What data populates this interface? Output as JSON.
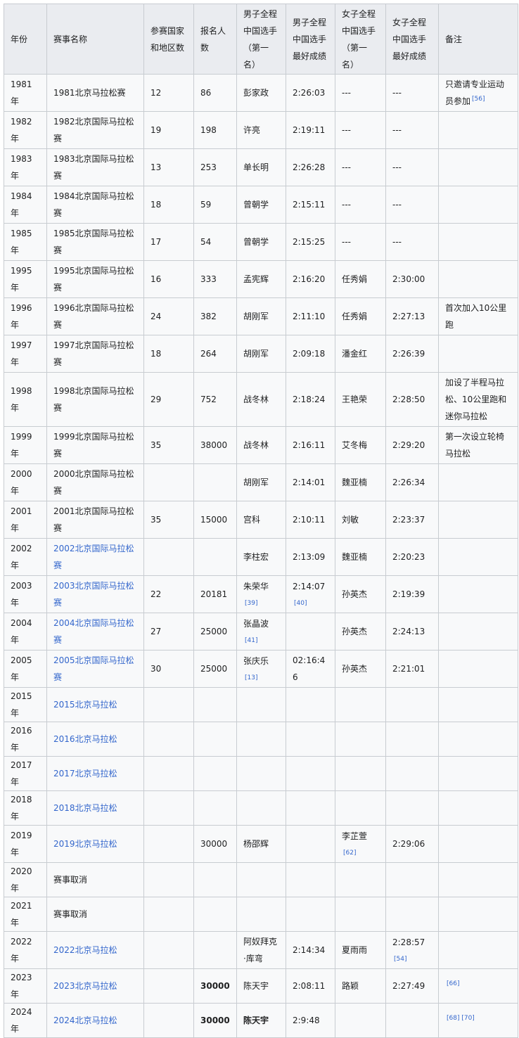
{
  "headers": {
    "year": "年份",
    "name": "赛事名称",
    "countries": "参赛国家和地区数",
    "entrants": "报名人数",
    "men_first": "男子全程中国选手（第一名）",
    "men_best": "男子全程中国选手最好成绩",
    "women_first": "女子全程中国选手（第一名）",
    "women_best": "女子全程中国选手最好成绩",
    "notes": "备注"
  },
  "rows": [
    {
      "year": "1981年",
      "name": "1981北京马拉松赛",
      "countries": "12",
      "entrants": "86",
      "men_first": "彭家政",
      "men_best": "2:26:03",
      "women_first": "---",
      "women_best": "---",
      "notes": "只邀请专业运动员参加",
      "notes_ref": "[56]"
    },
    {
      "year": "1982年",
      "name": "1982北京国际马拉松赛",
      "countries": "19",
      "entrants": "198",
      "men_first": "许亮",
      "men_best": "2:19:11",
      "women_first": "---",
      "women_best": "---",
      "notes": ""
    },
    {
      "year": "1983年",
      "name": "1983北京国际马拉松赛",
      "countries": "13",
      "entrants": "253",
      "men_first": "单长明",
      "men_best": "2:26:28",
      "women_first": "---",
      "women_best": "---",
      "notes": ""
    },
    {
      "year": "1984年",
      "name": "1984北京国际马拉松赛",
      "countries": "18",
      "entrants": "59",
      "men_first": "曾朝学",
      "men_best": "2:15:11",
      "women_first": "---",
      "women_best": "---",
      "notes": ""
    },
    {
      "year": "1985年",
      "name": "1985北京国际马拉松赛",
      "countries": "17",
      "entrants": "54",
      "men_first": "曾朝学",
      "men_best": "2:15:25",
      "women_first": "---",
      "women_best": "---",
      "notes": ""
    },
    {
      "year": "1995年",
      "name": "1995北京国际马拉松赛",
      "countries": "16",
      "entrants": "333",
      "men_first": "孟宪辉",
      "men_best": "2:16:20",
      "women_first": "任秀娟",
      "women_best": "2:30:00",
      "notes": ""
    },
    {
      "year": "1996年",
      "name": "1996北京国际马拉松赛",
      "countries": "24",
      "entrants": "382",
      "men_first": "胡刚军",
      "men_best": "2:11:10",
      "women_first": "任秀娟",
      "women_best": "2:27:13",
      "notes": "首次加入10公里跑"
    },
    {
      "year": "1997年",
      "name": "1997北京国际马拉松赛",
      "countries": "18",
      "entrants": "264",
      "men_first": "胡刚军",
      "men_best": "2:09:18",
      "women_first": "潘金红",
      "women_best": "2:26:39",
      "notes": ""
    },
    {
      "year": "1998年",
      "name": "1998北京国际马拉松赛",
      "countries": "29",
      "entrants": "752",
      "men_first": "战冬林",
      "men_best": "2:18:24",
      "women_first": "王艳荣",
      "women_best": "2:28:50",
      "notes": "加设了半程马拉松、10公里跑和迷你马拉松"
    },
    {
      "year": "1999年",
      "name": "1999北京国际马拉松赛",
      "countries": "35",
      "entrants": "38000",
      "men_first": "战冬林",
      "men_best": "2:16:11",
      "women_first": "艾冬梅",
      "women_best": "2:29:20",
      "notes": "第一次设立轮椅马拉松"
    },
    {
      "year": "2000年",
      "name": "2000北京国际马拉松赛",
      "countries": "",
      "entrants": "",
      "men_first": "胡刚军",
      "men_best": "2:14:01",
      "women_first": "魏亚楠",
      "women_best": "2:26:34",
      "notes": ""
    },
    {
      "year": "2001年",
      "name": "2001北京国际马拉松赛",
      "countries": "35",
      "entrants": "15000",
      "men_first": "宫科",
      "men_best": "2:10:11",
      "women_first": "刘敏",
      "women_best": "2:23:37",
      "notes": ""
    },
    {
      "year": "2002年",
      "name": "2002北京国际马拉松赛",
      "name_link": true,
      "countries": "",
      "entrants": "",
      "men_first": "李柱宏",
      "men_best": "2:13:09",
      "women_first": "魏亚楠",
      "women_best": "2:20:23",
      "notes": ""
    },
    {
      "year": "2003年",
      "name": "2003北京国际马拉松赛",
      "name_link": true,
      "countries": "22",
      "entrants": "20181",
      "men_first": "朱荣华",
      "men_first_ref": "[39]",
      "men_best": "2:14:07",
      "men_best_ref": "[40]",
      "women_first": "孙英杰",
      "women_best": "2:19:39",
      "notes": ""
    },
    {
      "year": "2004年",
      "name": "2004北京国际马拉松赛",
      "name_link": true,
      "countries": "27",
      "entrants": "25000",
      "men_first": "张晶波",
      "men_first_ref": "[41]",
      "men_best": "",
      "women_first": "孙英杰",
      "women_best": "2:24:13",
      "notes": ""
    },
    {
      "year": "2005年",
      "name": "2005北京国际马拉松赛",
      "name_link": true,
      "countries": "30",
      "entrants": "25000",
      "men_first": "张庆乐",
      "men_first_ref": "[13]",
      "men_best": "02:16:46",
      "women_first": "孙英杰",
      "women_best": "2:21:01",
      "notes": ""
    },
    {
      "year": "2015年",
      "name": "2015北京马拉松",
      "name_link": true,
      "countries": "",
      "entrants": "",
      "men_first": "",
      "men_best": "",
      "women_first": "",
      "women_best": "",
      "notes": ""
    },
    {
      "year": "2016年",
      "name": "2016北京马拉松",
      "name_link": true,
      "countries": "",
      "entrants": "",
      "men_first": "",
      "men_best": "",
      "women_first": "",
      "women_best": "",
      "notes": ""
    },
    {
      "year": "2017年",
      "name": "2017北京马拉松",
      "name_link": true,
      "countries": "",
      "entrants": "",
      "men_first": "",
      "men_best": "",
      "women_first": "",
      "women_best": "",
      "notes": ""
    },
    {
      "year": "2018年",
      "name": "2018北京马拉松",
      "name_link": true,
      "countries": "",
      "entrants": "",
      "men_first": "",
      "men_best": "",
      "women_first": "",
      "women_best": "",
      "notes": ""
    },
    {
      "year": "2019年",
      "name": "2019北京马拉松",
      "name_link": true,
      "countries": "",
      "entrants": "30000",
      "men_first": "杨邵辉",
      "men_best": "",
      "women_first": "李芷萱",
      "women_first_ref": "[62]",
      "women_best": "2:29:06",
      "notes": ""
    },
    {
      "year": "2020年",
      "name": "赛事取消",
      "countries": "",
      "entrants": "",
      "men_first": "",
      "men_best": "",
      "women_first": "",
      "women_best": "",
      "notes": ""
    },
    {
      "year": "2021年",
      "name": "赛事取消",
      "countries": "",
      "entrants": "",
      "men_first": "",
      "men_best": "",
      "women_first": "",
      "women_best": "",
      "notes": ""
    },
    {
      "year": "2022年",
      "name": "2022北京马拉松",
      "name_link": true,
      "countries": "",
      "entrants": "",
      "men_first": "阿奴拜克·库弯",
      "men_best": "2:14:34",
      "women_first": "夏雨雨",
      "women_best": "2:28:57",
      "women_best_ref": "[54]",
      "notes": ""
    },
    {
      "year": "2023年",
      "name": "2023北京马拉松",
      "name_link": true,
      "countries": "",
      "entrants": "30000",
      "entrants_bold": true,
      "men_first": "陈天宇",
      "men_best": "2:08:11",
      "women_first": "路颖",
      "women_best": "2:27:49",
      "notes": "",
      "notes_ref": "[66]"
    },
    {
      "year": "2024年",
      "name": "2024北京马拉松",
      "name_link": true,
      "countries": "",
      "entrants": "30000",
      "entrants_bold": true,
      "men_first": "陈天宇",
      "men_first_bold": true,
      "men_best": "2:9:48",
      "women_first": "",
      "women_best": "",
      "notes": "",
      "notes_ref": "[68] [70]"
    }
  ]
}
